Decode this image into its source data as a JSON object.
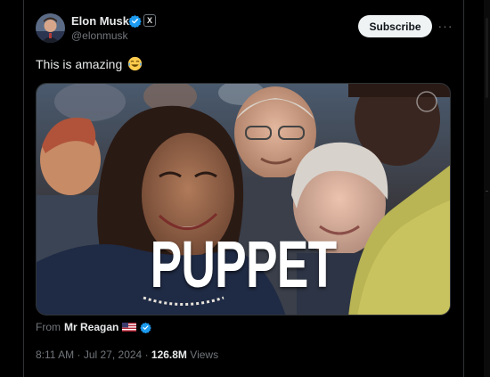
{
  "author": {
    "name": "Elon Musk",
    "handle": "@elonmusk",
    "affiliate_badge": "X"
  },
  "header": {
    "subscribe_label": "Subscribe",
    "more_label": "···"
  },
  "tweet": {
    "text": "This is amazing",
    "emoji": "face-with-tears-of-joy",
    "media_caption": "PUPPET"
  },
  "source": {
    "from_label": "From",
    "from_name": "Mr Reagan"
  },
  "meta": {
    "time": "8:11 AM",
    "date": "Jul 27, 2024",
    "separator": "·",
    "views_count": "126.8M",
    "views_label": "Views"
  },
  "colors": {
    "background": "#000000",
    "verified_blue": "#1d9bf0",
    "text_primary": "#e7e9ea",
    "text_secondary": "#71767b",
    "subscribe_bg": "#eff3f4"
  }
}
